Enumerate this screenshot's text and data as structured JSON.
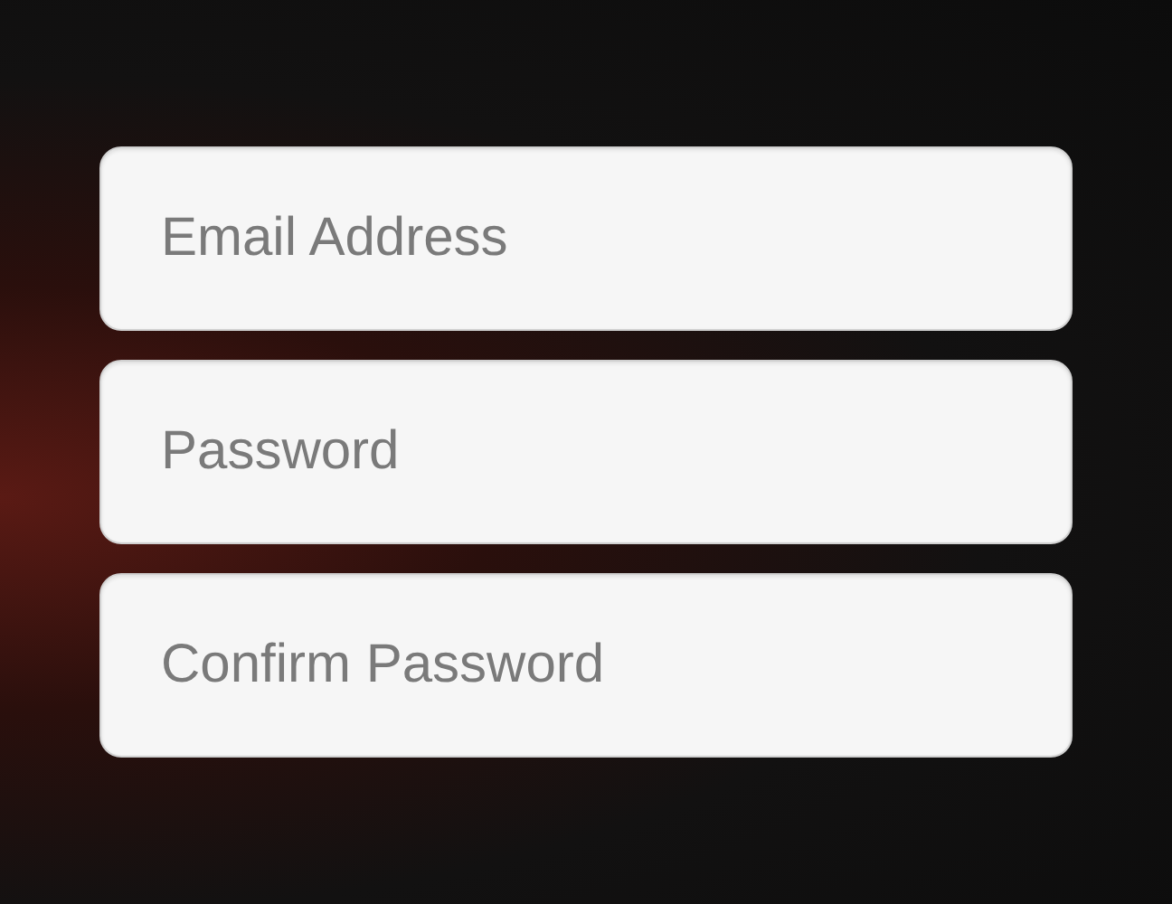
{
  "fields": [
    {
      "placeholder": "Email Address"
    },
    {
      "placeholder": "Password"
    },
    {
      "placeholder": "Confirm Password"
    }
  ]
}
